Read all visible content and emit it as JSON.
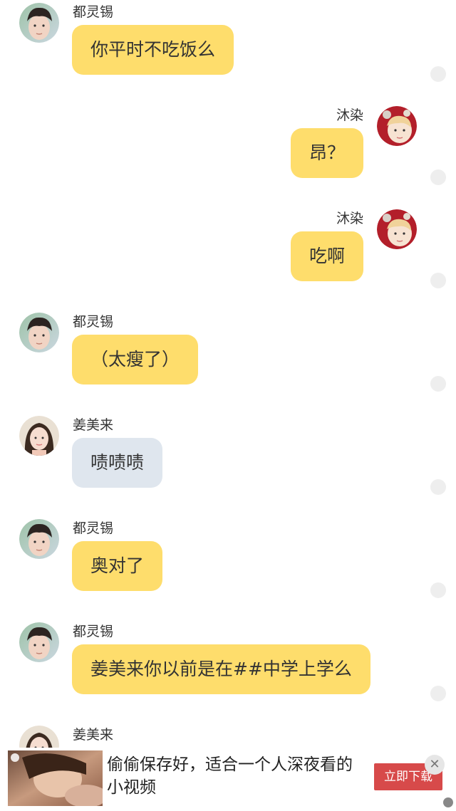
{
  "messages": [
    {
      "side": "left",
      "sender": "都灵锡",
      "text": "你平时不吃饭么",
      "bubble": "yellow",
      "avatar": "boy-avatar"
    },
    {
      "side": "right",
      "sender": "沐染",
      "text": "昂？",
      "bubble": "yellow",
      "avatar": "girl-red-avatar"
    },
    {
      "side": "right",
      "sender": "沐染",
      "text": "吃啊",
      "bubble": "yellow",
      "avatar": "girl-red-avatar"
    },
    {
      "side": "left",
      "sender": "都灵锡",
      "text": "（太瘦了）",
      "bubble": "yellow",
      "avatar": "boy-avatar"
    },
    {
      "side": "left",
      "sender": "姜美来",
      "text": "啧啧啧",
      "bubble": "grey",
      "avatar": "girl-avatar"
    },
    {
      "side": "left",
      "sender": "都灵锡",
      "text": "奥对了",
      "bubble": "yellow",
      "avatar": "boy-avatar"
    },
    {
      "side": "left",
      "sender": "都灵锡",
      "text": "姜美来你以前是在##中学上学么",
      "bubble": "yellow",
      "avatar": "boy-avatar"
    },
    {
      "side": "left",
      "sender": "姜美来",
      "text": "",
      "bubble": "none",
      "avatar": "girl-avatar"
    }
  ],
  "ad": {
    "text": "偷偷保存好，适合一个人深夜看的小视频",
    "button_label": "立即下载",
    "close_icon": "close-icon"
  },
  "colors": {
    "bubble_yellow": "#fedd6c",
    "bubble_grey": "#dfe6ee",
    "ad_button": "#d74a4a"
  }
}
